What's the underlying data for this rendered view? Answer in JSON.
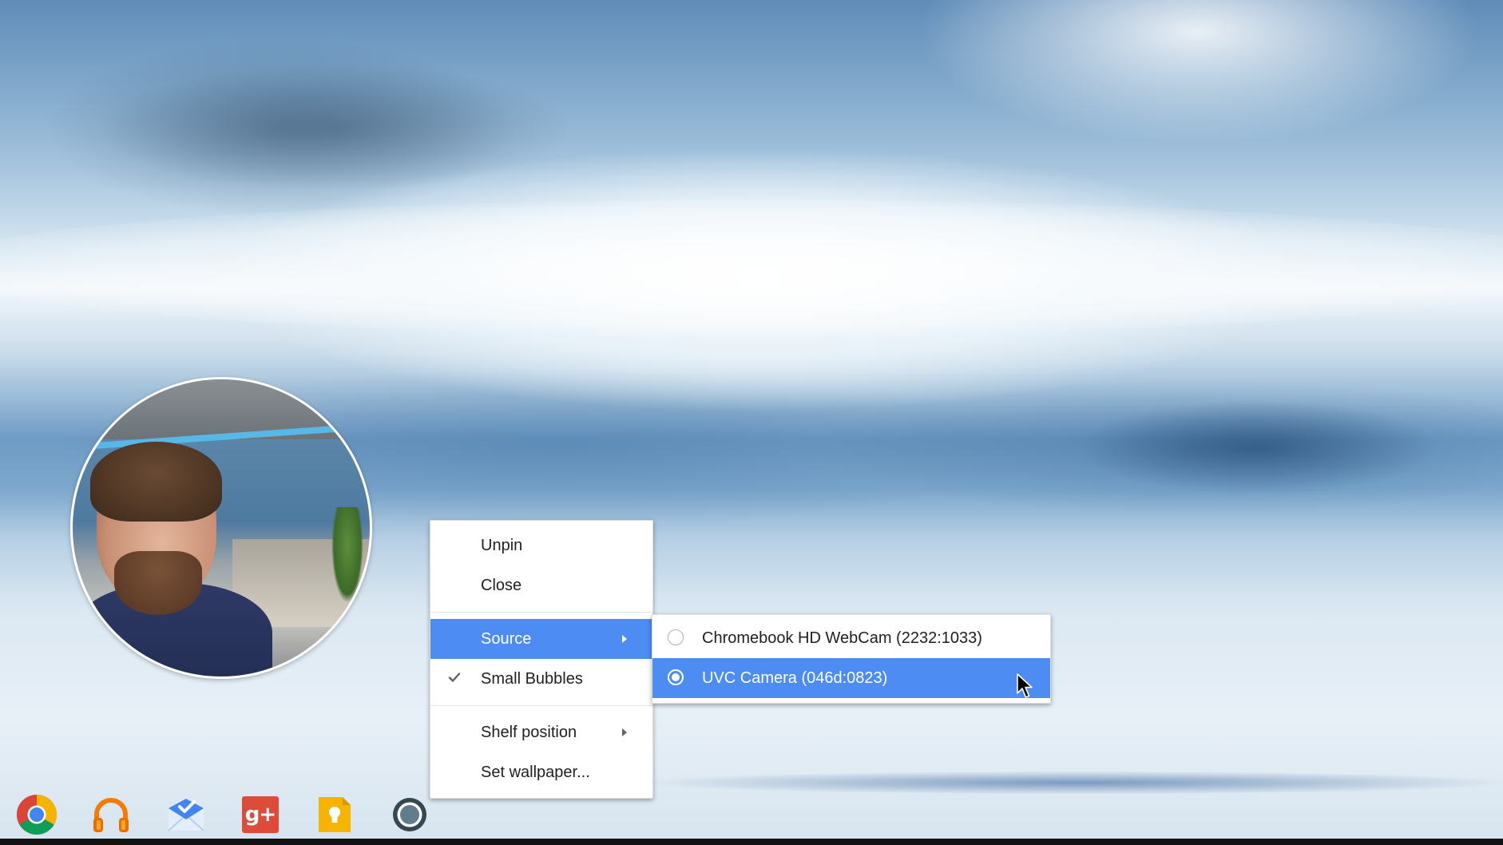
{
  "wallpaper": {
    "description_colors": {
      "sky_blue": "#5f8cb8",
      "snow": "#e8f0f7",
      "cloud": "#ffffff"
    }
  },
  "webcam_bubble": {
    "icon": "webcam-feed"
  },
  "context_menu": {
    "items": [
      {
        "label": "Unpin"
      },
      {
        "label": "Close"
      },
      {
        "label": "Source",
        "has_submenu": true,
        "active": true
      },
      {
        "label": "Small Bubbles",
        "checked": true
      },
      {
        "label": "Shelf position",
        "has_submenu": true
      },
      {
        "label": "Set wallpaper..."
      }
    ]
  },
  "source_submenu": {
    "options": [
      {
        "label": "Chromebook HD WebCam (2232:1033)",
        "selected": false
      },
      {
        "label": "UVC Camera (046d:0823)",
        "selected": true
      }
    ]
  },
  "shelf": {
    "apps": [
      {
        "name": "chrome-icon"
      },
      {
        "name": "music-headphones-icon"
      },
      {
        "name": "inbox-icon"
      },
      {
        "name": "google-plus-icon",
        "text": "g+"
      },
      {
        "name": "keep-icon"
      },
      {
        "name": "webcam-app-icon"
      }
    ]
  },
  "colors": {
    "highlight": "#4c8cf3",
    "menu_bg": "#ffffff",
    "menu_text": "#202124"
  }
}
